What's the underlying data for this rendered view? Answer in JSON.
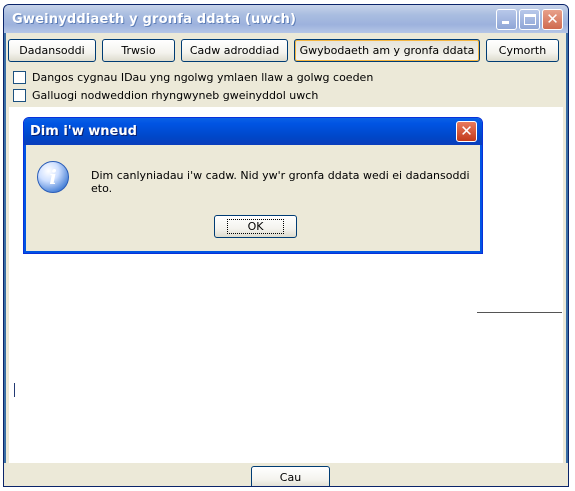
{
  "window": {
    "title": "Gweinyddiaeth y gronfa ddata (uwch)",
    "buttons": [
      "minimize",
      "maximize",
      "close"
    ]
  },
  "toolbar": {
    "analyse": "Dadansoddi",
    "repair": "Trwsio",
    "save_report": "Cadw adroddiad",
    "db_info": "Gwybodaeth am y gronfa ddata",
    "help": "Cymorth"
  },
  "options": [
    {
      "label": "Dangos cygnau IDau yng ngolwg ymlaen llaw a golwg coeden",
      "checked": false
    },
    {
      "label": "Galluogi nodweddion rhyngwyneb gweinyddol uwch",
      "checked": false
    }
  ],
  "footer": {
    "close_label": "Cau"
  },
  "dialog": {
    "title": "Dim i'w wneud",
    "icon": "info-icon",
    "message": "Dim canlyniadau i'w cadw. Nid yw'r gronfa ddata wedi ei dadansoddi eto.",
    "ok_label": "OK"
  },
  "colors": {
    "window_title_bg": "#a9bde0",
    "dialog_title_bg": "#0054e3",
    "chrome_bg": "#ece9d8"
  }
}
